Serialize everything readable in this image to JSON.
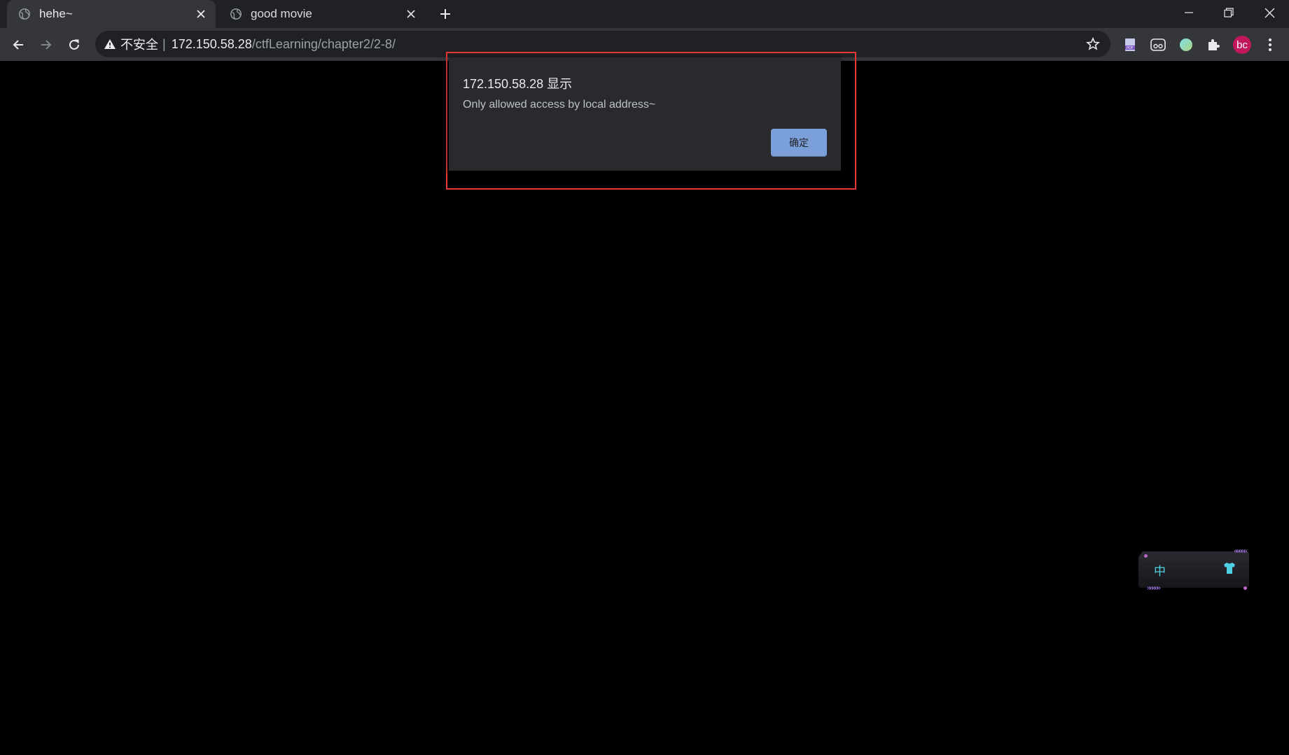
{
  "browser": {
    "tabs": [
      {
        "title": "hehe~",
        "active": true
      },
      {
        "title": "good movie",
        "active": false
      }
    ],
    "address_bar": {
      "security_label": "不安全",
      "separator": "|",
      "url_host": "172.150.58.28",
      "url_path": "/ctfLearning/chapter2/2-8/"
    },
    "profile_initials": "bc",
    "extension_icons": [
      "pdf-extension-icon",
      "reader-extension-icon",
      "circle-extension-icon",
      "puzzle-extensions-icon"
    ]
  },
  "dialog": {
    "title": "172.150.58.28 显示",
    "message": "Only allowed access by local address~",
    "ok_label": "确定"
  },
  "widget": {
    "lang_label": "中",
    "arrows_top": "«««««",
    "arrows_bottom": "»»»»»"
  },
  "colors": {
    "page_background": "#000000",
    "tab_strip": "#202124",
    "toolbar": "#35363a",
    "dialog_background": "#292a2d",
    "dialog_button": "#8ab4f8",
    "highlight_border": "#e53935",
    "avatar": "#c2185b"
  }
}
